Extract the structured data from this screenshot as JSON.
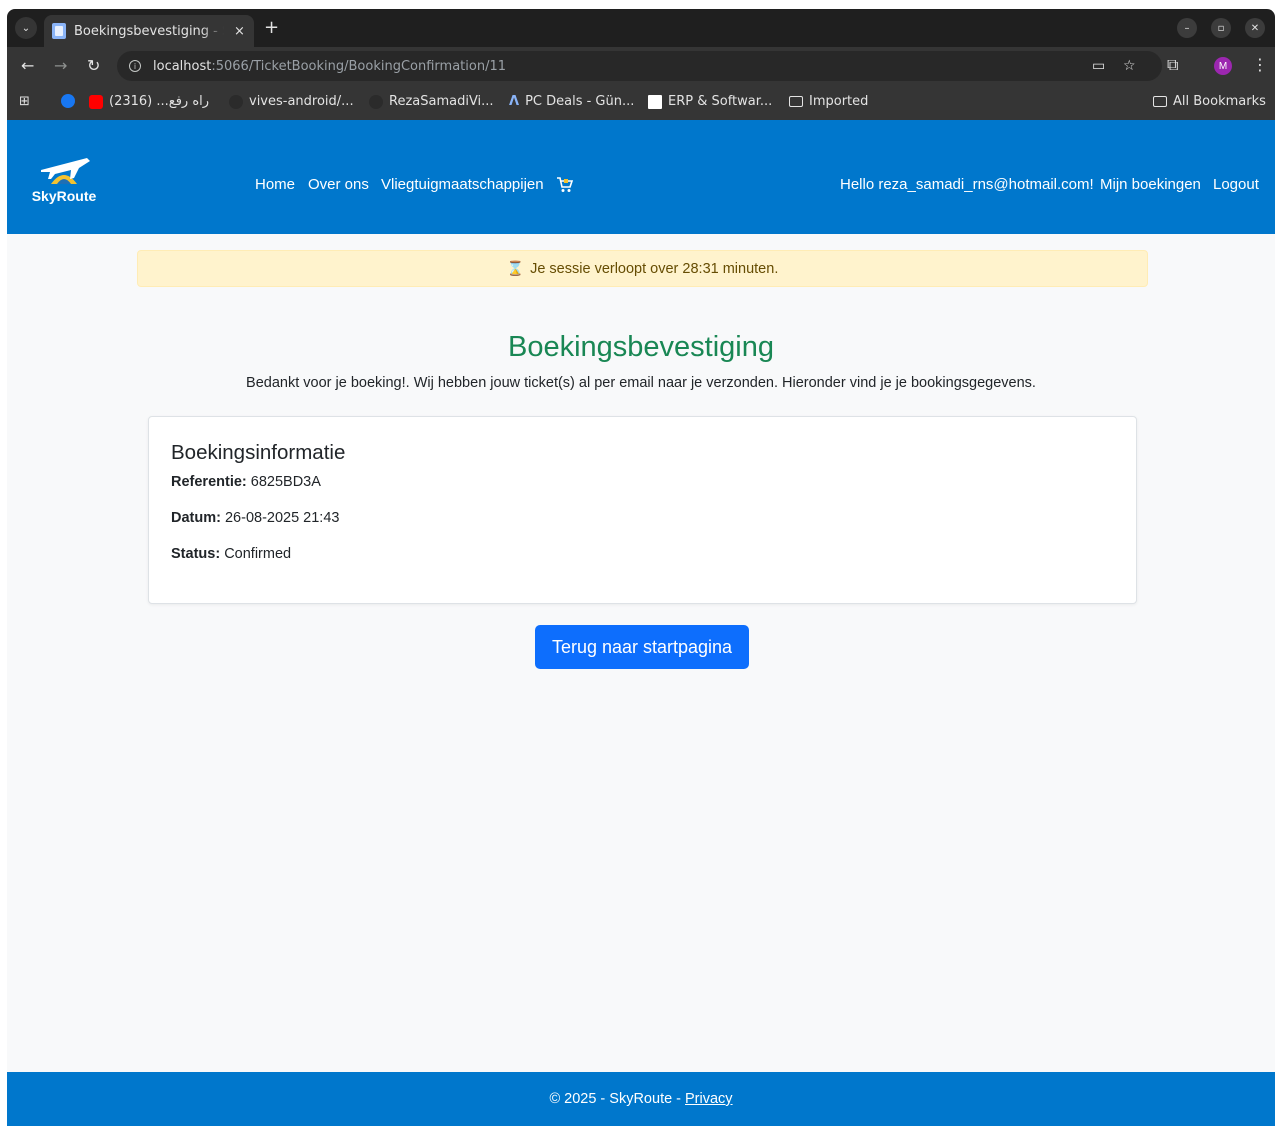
{
  "browser": {
    "tab_title": "Boekingsbevestiging - SkyRoute",
    "tab_close": "×",
    "new_tab": "+",
    "url_host": "localhost",
    "url_rest": ":5066/TicketBooking/BookingConfirmation/11",
    "profile_initial": "M",
    "bookmarks": [
      {
        "label": "راه رفع... (2316)",
        "icon": "youtube-icon",
        "color": "#ff0000"
      },
      {
        "label": "vives-android/...",
        "icon": "github-icon",
        "color": "#2b2b2b"
      },
      {
        "label": "RezaSamadiVi...",
        "icon": "github-icon",
        "color": "#2b2b2b"
      },
      {
        "label": "PC Deals - Gün...",
        "icon": "triangle-icon",
        "color": "#1a73e8"
      },
      {
        "label": "ERP & Softwar...",
        "icon": "page-icon",
        "color": "#ffffff"
      },
      {
        "label": "Imported",
        "icon": "folder-icon",
        "color": "#e3e3e3"
      }
    ],
    "all_bookmarks": "All Bookmarks"
  },
  "site": {
    "logo_text": "SkyRoute",
    "nav": {
      "home": "Home",
      "about": "Over ons",
      "airlines": "Vliegtuigmaatschappijen"
    },
    "user": {
      "greeting": "Hello reza_samadi_rns@hotmail.com!",
      "my_bookings": "Mijn boekingen",
      "logout": "Logout"
    },
    "brand_color": "#0077cc"
  },
  "session_alert": "Je sessie verloopt over 28:31 minuten.",
  "main": {
    "title": "Boekingsbevestiging",
    "lead": "Bedankt voor je boeking!. Wij hebben jouw ticket(s) al per email naar je verzonden. Hieronder vind je je bookingsgegevens.",
    "card": {
      "title": "Boekingsinformatie",
      "reference_label": "Referentie:",
      "reference_value": "6825BD3A",
      "date_label": "Datum:",
      "date_value": "26-08-2025 21:43",
      "status_label": "Status:",
      "status_value": "Confirmed"
    },
    "button_home": "Terug naar startpagina"
  },
  "footer": {
    "copyright": "© 2025 - SkyRoute -",
    "privacy": "Privacy"
  }
}
